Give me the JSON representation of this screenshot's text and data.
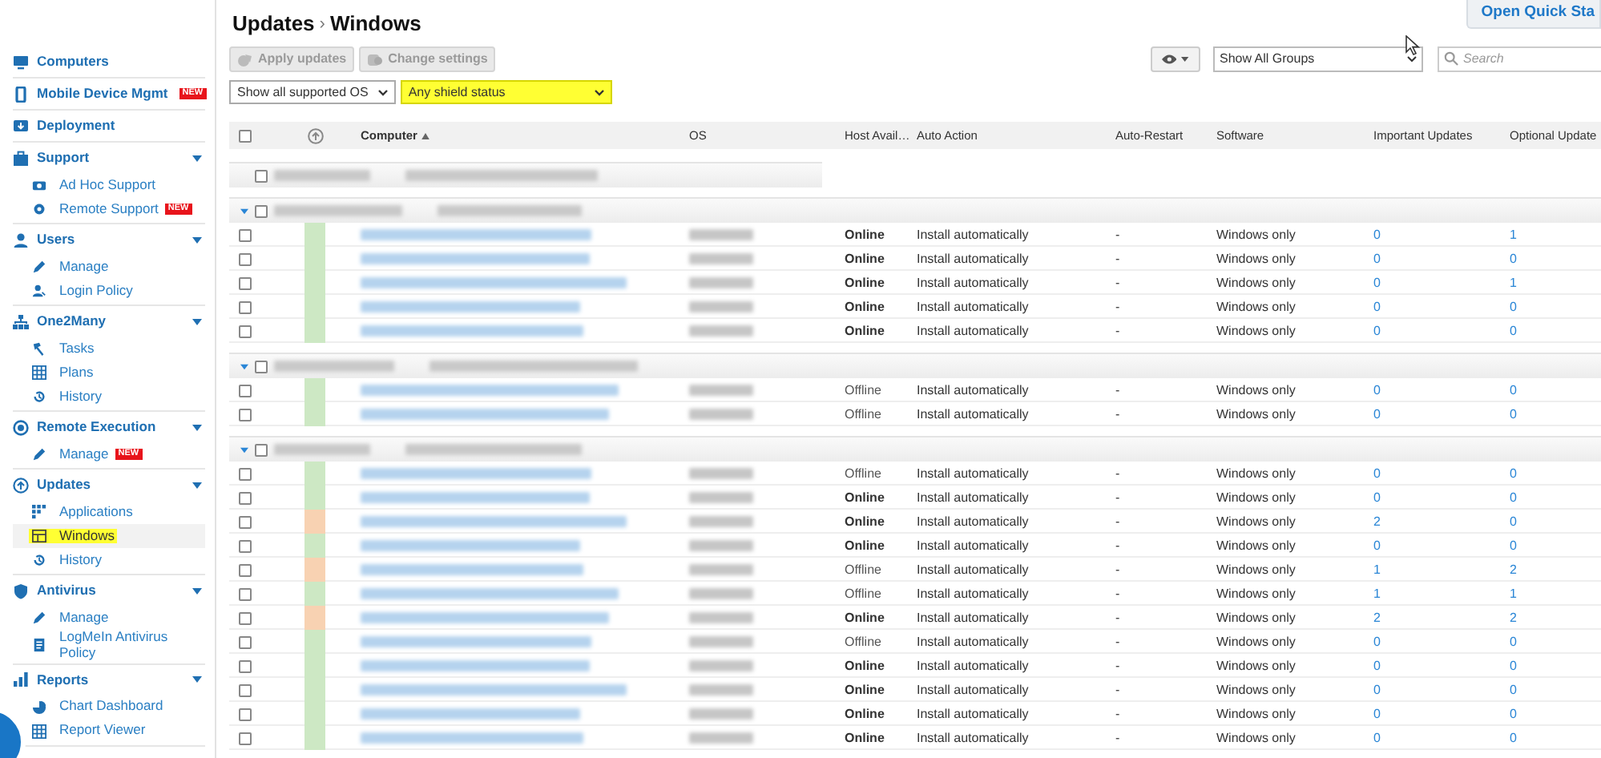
{
  "sidebar": {
    "sections": [
      {
        "label": "Computers",
        "expandable": false
      },
      {
        "label": "Mobile Device Mgmt",
        "expandable": false,
        "badge": "NEW"
      },
      {
        "label": "Deployment",
        "expandable": false
      },
      {
        "label": "Support",
        "expandable": true,
        "children": [
          {
            "label": "Ad Hoc Support",
            "selected": false
          },
          {
            "label": "Remote Support",
            "selected": false,
            "badge": "NEW"
          }
        ]
      },
      {
        "label": "Users",
        "expandable": true,
        "children": [
          {
            "label": "Manage",
            "selected": false
          },
          {
            "label": "Login Policy",
            "selected": false
          }
        ]
      },
      {
        "label": "One2Many",
        "expandable": true,
        "children": [
          {
            "label": "Tasks",
            "selected": false
          },
          {
            "label": "Plans",
            "selected": false
          },
          {
            "label": "History",
            "selected": false
          }
        ]
      },
      {
        "label": "Remote Execution",
        "expandable": true,
        "children": [
          {
            "label": "Manage",
            "selected": false,
            "badge": "NEW"
          }
        ]
      },
      {
        "label": "Updates",
        "expandable": true,
        "children": [
          {
            "label": "Applications",
            "selected": false
          },
          {
            "label": "Windows",
            "selected": true
          },
          {
            "label": "History",
            "selected": false
          }
        ]
      },
      {
        "label": "Antivirus",
        "expandable": true,
        "children": [
          {
            "label": "Manage",
            "selected": false
          },
          {
            "label": "LogMeIn Antivirus Policy",
            "selected": false
          }
        ]
      },
      {
        "label": "Reports",
        "expandable": true,
        "children": [
          {
            "label": "Chart Dashboard",
            "selected": false
          },
          {
            "label": "Report Viewer",
            "selected": false
          }
        ]
      }
    ]
  },
  "header": {
    "breadcrumb": [
      "Updates",
      "Windows"
    ],
    "separator": "›",
    "quick_start": "Open Quick Sta"
  },
  "toolbar": {
    "buttons": [
      {
        "label": "Apply updates",
        "disabled": true
      },
      {
        "label": "Change settings",
        "disabled": true
      }
    ],
    "group_select": "Show All Groups",
    "search": {
      "placeholder": "Search"
    }
  },
  "filters": [
    {
      "value": "Show all supported OS",
      "highlighted": false
    },
    {
      "value": "Any shield status",
      "highlighted": true
    }
  ],
  "table": {
    "select_all": {
      "checked": false
    },
    "columns": [
      {
        "label": "Computer",
        "sorted": true
      },
      {
        "label": "OS",
        "sorted": false
      },
      {
        "label": "Host Avail…",
        "sorted": false
      },
      {
        "label": "Auto Action",
        "sorted": false
      },
      {
        "label": "Auto-Restart",
        "sorted": false
      },
      {
        "label": "Software",
        "sorted": false
      },
      {
        "label": "Important Updates",
        "sorted": false
      },
      {
        "label": "Optional Update",
        "sorted": false
      }
    ],
    "groups": [
      {
        "expanded": false,
        "checked": false
      },
      {
        "expanded": true,
        "checked": false,
        "rows": [
          {
            "checked": false,
            "color": "#cde8c4",
            "host": "Online",
            "online": true,
            "action": "Install automatically",
            "restart": "-",
            "software": "Windows only",
            "important": "0",
            "optional": "1"
          },
          {
            "checked": false,
            "color": "#cde8c4",
            "host": "Online",
            "online": true,
            "action": "Install automatically",
            "restart": "-",
            "software": "Windows only",
            "important": "0",
            "optional": "0"
          },
          {
            "checked": false,
            "color": "#cde8c4",
            "host": "Online",
            "online": true,
            "action": "Install automatically",
            "restart": "-",
            "software": "Windows only",
            "important": "0",
            "optional": "1"
          },
          {
            "checked": false,
            "color": "#cde8c4",
            "host": "Online",
            "online": true,
            "action": "Install automatically",
            "restart": "-",
            "software": "Windows only",
            "important": "0",
            "optional": "0"
          },
          {
            "checked": false,
            "color": "#cde8c4",
            "host": "Online",
            "online": true,
            "action": "Install automatically",
            "restart": "-",
            "software": "Windows only",
            "important": "0",
            "optional": "0"
          }
        ]
      },
      {
        "expanded": true,
        "checked": false,
        "rows": [
          {
            "checked": false,
            "color": "#cde8c4",
            "host": "Offline",
            "online": false,
            "action": "Install automatically",
            "restart": "-",
            "software": "Windows only",
            "important": "0",
            "optional": "0"
          },
          {
            "checked": false,
            "color": "#cde8c4",
            "host": "Offline",
            "online": false,
            "action": "Install automatically",
            "restart": "-",
            "software": "Windows only",
            "important": "0",
            "optional": "0"
          }
        ]
      },
      {
        "expanded": true,
        "checked": false,
        "rows": [
          {
            "checked": false,
            "color": "#cde8c4",
            "host": "Offline",
            "online": false,
            "action": "Install automatically",
            "restart": "-",
            "software": "Windows only",
            "important": "0",
            "optional": "0"
          },
          {
            "checked": false,
            "color": "#cde8c4",
            "host": "Online",
            "online": true,
            "action": "Install automatically",
            "restart": "-",
            "software": "Windows only",
            "important": "0",
            "optional": "0"
          },
          {
            "checked": false,
            "color": "#f8d2b2",
            "host": "Online",
            "online": true,
            "action": "Install automatically",
            "restart": "-",
            "software": "Windows only",
            "important": "2",
            "optional": "0"
          },
          {
            "checked": false,
            "color": "#cde8c4",
            "host": "Online",
            "online": true,
            "action": "Install automatically",
            "restart": "-",
            "software": "Windows only",
            "important": "0",
            "optional": "0"
          },
          {
            "checked": false,
            "color": "#f8d2b2",
            "host": "Offline",
            "online": false,
            "action": "Install automatically",
            "restart": "-",
            "software": "Windows only",
            "important": "1",
            "optional": "2"
          },
          {
            "checked": false,
            "color": "#cde8c4",
            "host": "Offline",
            "online": false,
            "action": "Install automatically",
            "restart": "-",
            "software": "Windows only",
            "important": "1",
            "optional": "1"
          },
          {
            "checked": false,
            "color": "#f8d2b2",
            "host": "Online",
            "online": true,
            "action": "Install automatically",
            "restart": "-",
            "software": "Windows only",
            "important": "2",
            "optional": "2"
          },
          {
            "checked": false,
            "color": "#cde8c4",
            "host": "Offline",
            "online": false,
            "action": "Install automatically",
            "restart": "-",
            "software": "Windows only",
            "important": "0",
            "optional": "0"
          },
          {
            "checked": false,
            "color": "#cde8c4",
            "host": "Online",
            "online": true,
            "action": "Install automatically",
            "restart": "-",
            "software": "Windows only",
            "important": "0",
            "optional": "0"
          },
          {
            "checked": false,
            "color": "#cde8c4",
            "host": "Online",
            "online": true,
            "action": "Install automatically",
            "restart": "-",
            "software": "Windows only",
            "important": "0",
            "optional": "0"
          },
          {
            "checked": false,
            "color": "#cde8c4",
            "host": "Online",
            "online": true,
            "action": "Install automatically",
            "restart": "-",
            "software": "Windows only",
            "important": "0",
            "optional": "0"
          },
          {
            "checked": false,
            "color": "#cde8c4",
            "host": "Online",
            "online": true,
            "action": "Install automatically",
            "restart": "-",
            "software": "Windows only",
            "important": "0",
            "optional": "0"
          }
        ]
      }
    ]
  }
}
